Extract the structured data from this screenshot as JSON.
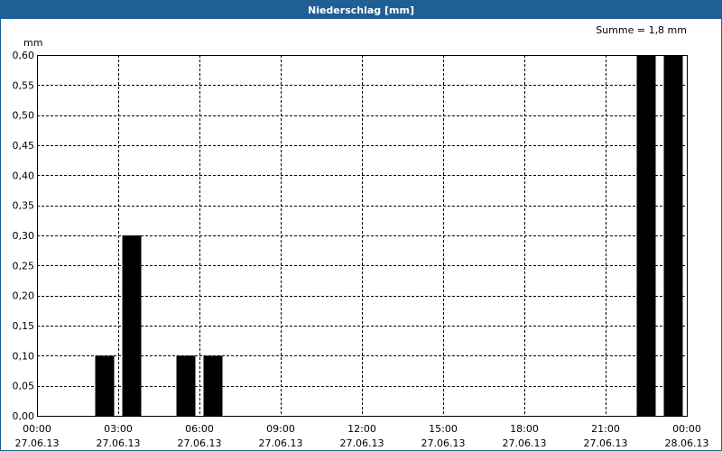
{
  "window": {
    "title": "Niederschlag [mm]"
  },
  "chart_data": {
    "type": "bar",
    "unit_label": "mm",
    "sum_label": "Summe = 1,8 mm",
    "ylim": [
      0,
      0.6
    ],
    "y_ticks": [
      "0,00",
      "0,05",
      "0,10",
      "0,15",
      "0,20",
      "0,25",
      "0,30",
      "0,35",
      "0,40",
      "0,45",
      "0,50",
      "0,55",
      "0,60"
    ],
    "x_range_hours": [
      0,
      24
    ],
    "x_ticks": [
      {
        "time": "00:00",
        "date": "27.06.13"
      },
      {
        "time": "03:00",
        "date": "27.06.13"
      },
      {
        "time": "06:00",
        "date": "27.06.13"
      },
      {
        "time": "09:00",
        "date": "27.06.13"
      },
      {
        "time": "12:00",
        "date": "27.06.13"
      },
      {
        "time": "15:00",
        "date": "27.06.13"
      },
      {
        "time": "18:00",
        "date": "27.06.13"
      },
      {
        "time": "21:00",
        "date": "27.06.13"
      },
      {
        "time": "00:00",
        "date": "28.06.13"
      }
    ],
    "bars": [
      {
        "hour": 2.5,
        "value": 0.1
      },
      {
        "hour": 3.5,
        "value": 0.3
      },
      {
        "hour": 5.5,
        "value": 0.1
      },
      {
        "hour": 6.5,
        "value": 0.1
      },
      {
        "hour": 22.5,
        "value": 0.6
      },
      {
        "hour": 23.5,
        "value": 0.6
      }
    ],
    "grid": true,
    "bar_color": "#000000"
  }
}
